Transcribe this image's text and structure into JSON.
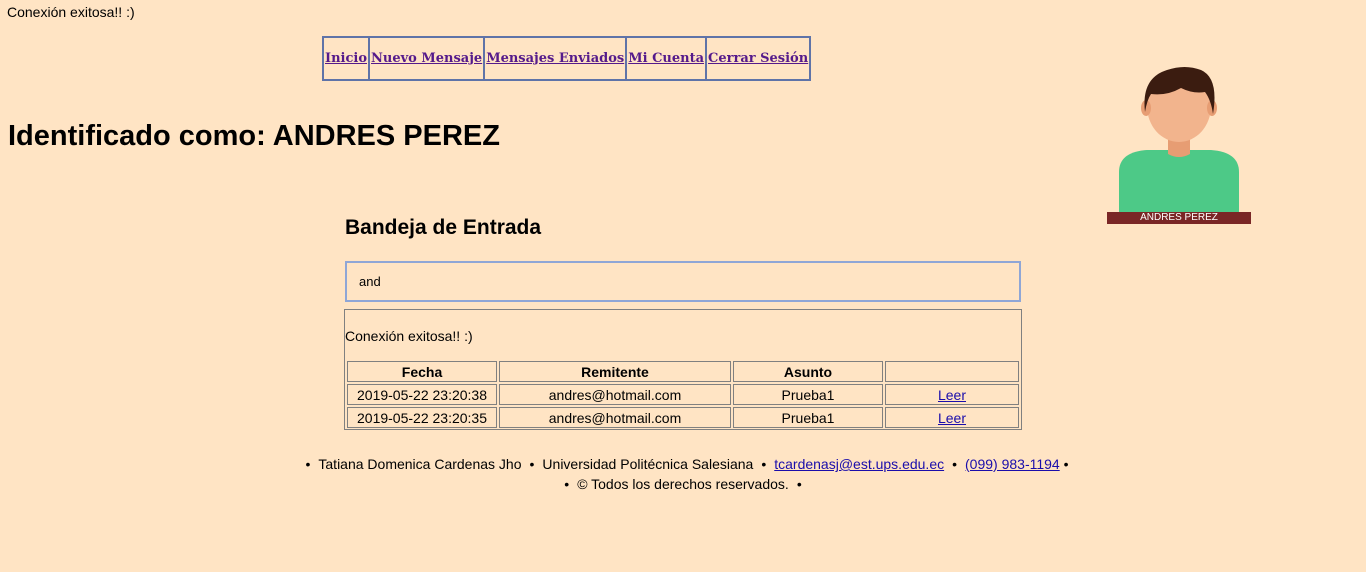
{
  "status_message": "Conexión exitosa!! :)",
  "nav": {
    "items": [
      {
        "label": "Inicio"
      },
      {
        "label": "Nuevo Mensaje"
      },
      {
        "label": "Mensajes Enviados"
      },
      {
        "label": "Mi Cuenta"
      },
      {
        "label": "Cerrar Sesión"
      }
    ]
  },
  "identified_as": "Identificado como: ANDRES PEREZ",
  "avatar": {
    "name": "ANDRES PEREZ",
    "colors": {
      "hair": "#3b1c10",
      "skin": "#f2b48d",
      "shirt": "#4dc987",
      "nameplate": "#7a2626"
    }
  },
  "inbox": {
    "title": "Bandeja de Entrada",
    "search_value": "and",
    "status": "Conexión exitosa!! :)",
    "headers": [
      "Fecha",
      "Remitente",
      "Asunto",
      ""
    ],
    "rows": [
      {
        "date": "2019-05-22 23:20:38",
        "sender": "andres@hotmail.com",
        "subject": "Prueba1",
        "action": "Leer"
      },
      {
        "date": "2019-05-22 23:20:35",
        "sender": "andres@hotmail.com",
        "subject": "Prueba1",
        "action": "Leer"
      }
    ]
  },
  "footer": {
    "name": "Tatiana Domenica Cardenas Jho",
    "university": "Universidad Politécnica Salesiana",
    "email": "tcardenasj@est.ups.edu.ec",
    "phone": "(099) 983-1194",
    "copyright": "© Todos los derechos reservados.",
    "bullet": "•"
  }
}
